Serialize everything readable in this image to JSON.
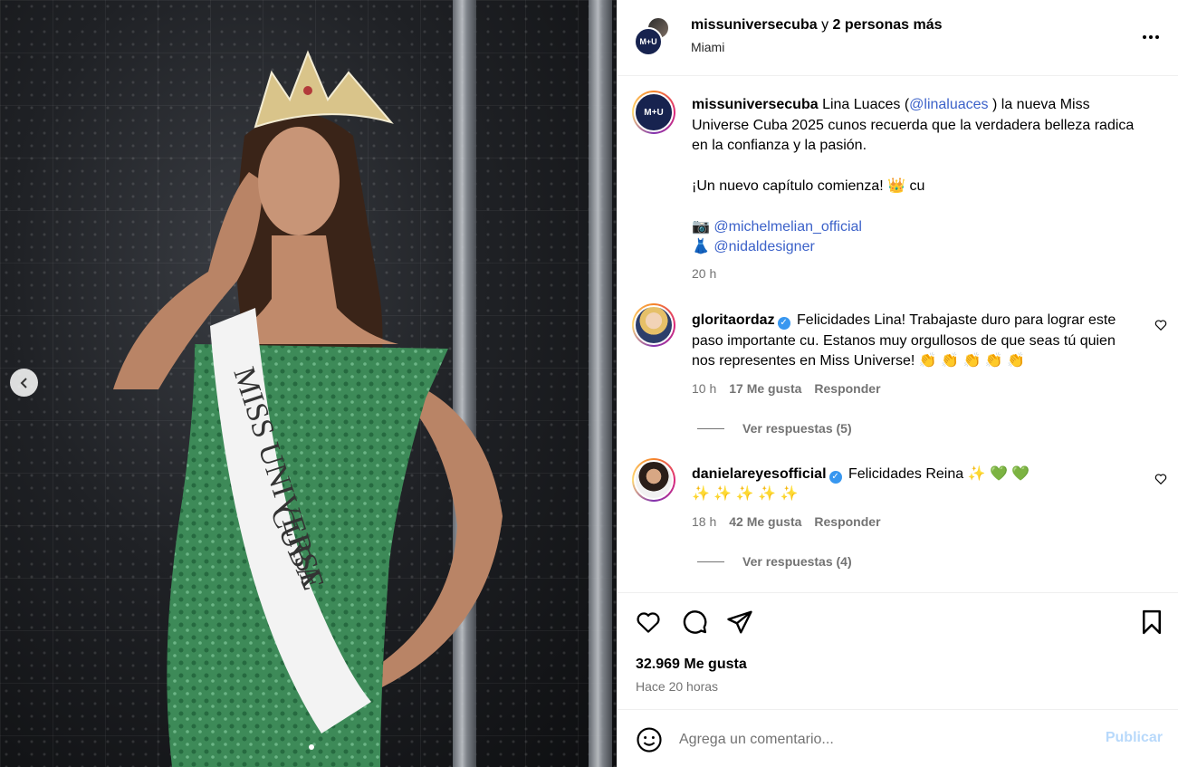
{
  "post": {
    "author": "missuniversecuba",
    "coauthors_connector": "y",
    "coauthors": "2 personas más",
    "location": "Miami",
    "avatar_label": "M+U"
  },
  "caption": {
    "username": "missuniversecuba",
    "text_part1": "Lina Luaces (",
    "mention": "@linaluaces",
    "text_part2": " ) la nueva Miss Universe Cuba 2025 cunos recuerda que la verdadera belleza radica en la confianza y la pasión.",
    "paragraph2": "¡Un nuevo capítulo comienza! 👑 cu",
    "credit1_icon": "📷",
    "credit1": "@michelmelian_official",
    "credit2_icon": "👗",
    "credit2": "@nidaldesigner",
    "time": "20 h"
  },
  "comments": [
    {
      "username": "gloritaordaz",
      "verified": true,
      "text": "Felicidades Lina! Trabajaste duro para lograr este paso importante cu. Estanos muy orgullosos de que seas tú quien nos represent​es en Miss Universe! 👏 👏 👏 👏 👏",
      "time": "10 h",
      "likes": "17 Me gusta",
      "reply": "Responder",
      "view_replies": "Ver respuestas (5)"
    },
    {
      "username": "danielareyesofficial",
      "verified": true,
      "text": "Felicidades Reina ✨ 💚 💚",
      "text_line2": "✨ ✨ ✨ ✨ ✨",
      "time": "18 h",
      "likes": "42 Me gusta",
      "reply": "Responder",
      "view_replies": "Ver respuestas (4)"
    }
  ],
  "actions": {
    "likes": "32.969 Me gusta",
    "posted_ago": "Hace 20 horas"
  },
  "composer": {
    "placeholder": "Agrega un comentario...",
    "post_label": "Publicar"
  },
  "image": {
    "sash_line1": "MISS UNIVERSE",
    "sash_line2": "CUBA"
  },
  "colors": {
    "link": "#3c62c9",
    "muted": "#737373",
    "verified": "#3897f0",
    "publish_disabled": "#b8d9fb"
  }
}
